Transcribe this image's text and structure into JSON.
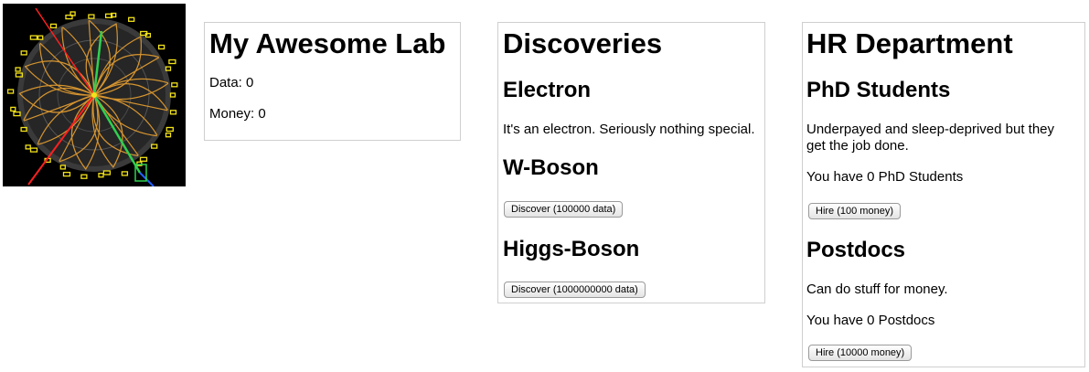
{
  "lab": {
    "title": "My Awesome Lab",
    "data_line": "Data: 0",
    "money_line": "Money: 0"
  },
  "discoveries": {
    "title": "Discoveries",
    "electron": {
      "name": "Electron",
      "description": "It's an electron. Seriously nothing special."
    },
    "wboson": {
      "name": "W-Boson",
      "button": "Discover (100000 data)"
    },
    "higgs": {
      "name": "Higgs-Boson",
      "button": "Discover (1000000000 data)"
    }
  },
  "hr": {
    "title": "HR Department",
    "phd": {
      "name": "PhD Students",
      "description": "Underpayed and sleep-deprived but they get the job done.",
      "count_line": "You have 0 PhD Students",
      "button": "Hire (100 money)"
    },
    "postdoc": {
      "name": "Postdocs",
      "description": "Can do stuff for money.",
      "count_line": "You have 0 Postdocs",
      "button": "Hire (10000 money)"
    }
  },
  "logo_image": {
    "icon": "particle-collision-event-display",
    "colors": [
      "#000000",
      "#e8a030",
      "#f2e21a",
      "#ff2020",
      "#30d050",
      "#2060ff"
    ]
  }
}
